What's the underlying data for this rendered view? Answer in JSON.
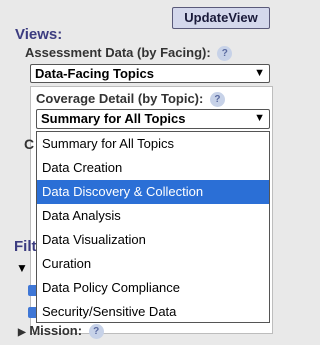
{
  "toolbar": {
    "update_label": "UpdateView"
  },
  "views": {
    "title": "Views:",
    "assessment": {
      "label": "Assessment Data (by Facing):",
      "help": "?",
      "selected": "Data-Facing Topics"
    },
    "coverage": {
      "label": "Coverage Detail (by Topic):",
      "help": "?",
      "selected": "Summary for All Topics",
      "options": [
        "Summary for All Topics",
        "Data Creation",
        "Data Discovery & Collection",
        "Data Analysis",
        "Data Visualization",
        "Curation",
        "Data Policy Compliance",
        "Security/Sensitive Data"
      ],
      "highlighted_index": 2
    }
  },
  "filter_partial": "Filt",
  "mission": {
    "label": "Mission:",
    "help": "?"
  }
}
